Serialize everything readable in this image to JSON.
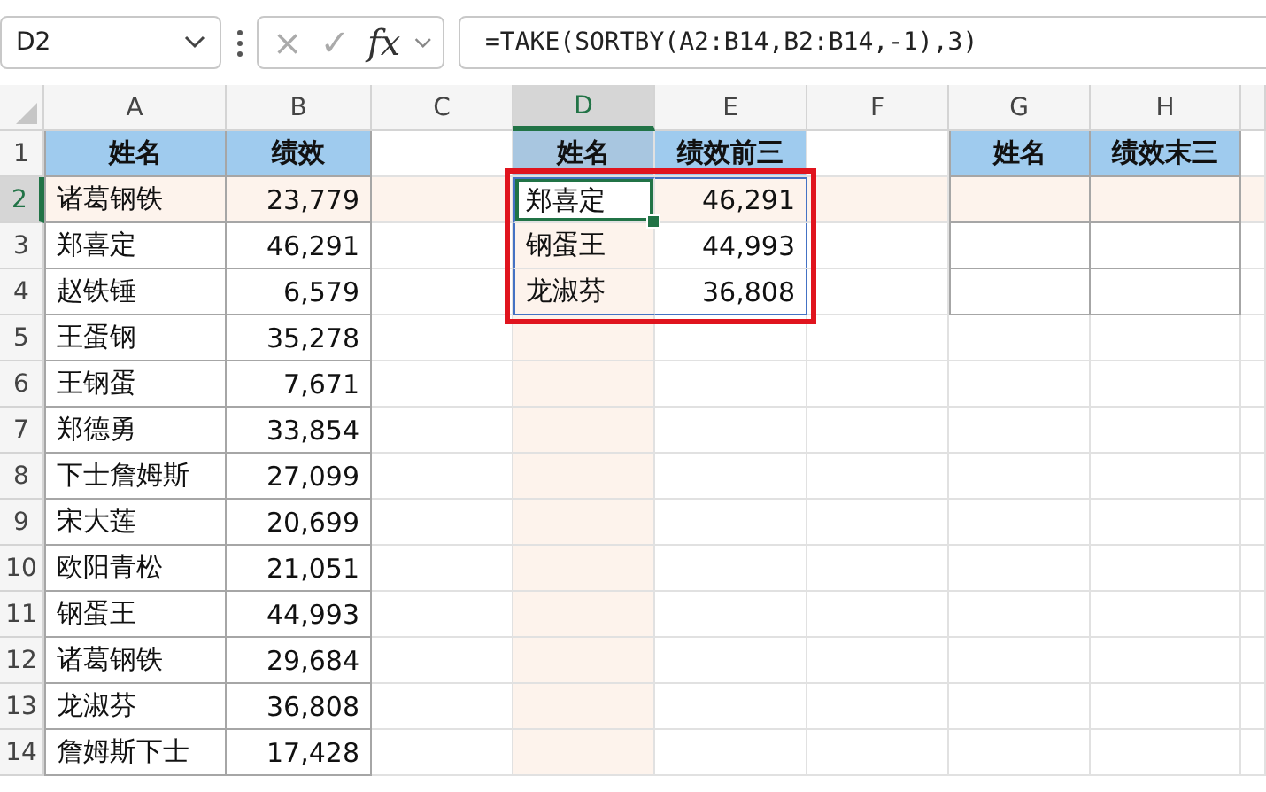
{
  "name_box": "D2",
  "formula_bar": {
    "cancel": "×",
    "enter": "✓",
    "function": "fx",
    "formula": "=TAKE(SORTBY(A2:B14,B2:B14,-1),3)"
  },
  "columns": [
    {
      "label": "A",
      "selected": false
    },
    {
      "label": "B",
      "selected": false
    },
    {
      "label": "C",
      "selected": false
    },
    {
      "label": "D",
      "selected": true
    },
    {
      "label": "E",
      "selected": false
    },
    {
      "label": "F",
      "selected": false
    },
    {
      "label": "G",
      "selected": false
    },
    {
      "label": "H",
      "selected": false
    }
  ],
  "rows": [
    {
      "number": "1",
      "selected": false,
      "kind": "header",
      "cells": {
        "A": "姓名",
        "B": "绩效",
        "D": "姓名",
        "E": "绩效前三",
        "G": "姓名",
        "H": "绩效末三"
      }
    },
    {
      "number": "2",
      "selected": true,
      "kind": "data",
      "cells": {
        "A": "诸葛钢铁",
        "B": "23,779",
        "D": "郑喜定",
        "E": "46,291"
      }
    },
    {
      "number": "3",
      "selected": false,
      "kind": "data",
      "cells": {
        "A": "郑喜定",
        "B": "46,291",
        "D": "钢蛋王",
        "E": "44,993"
      }
    },
    {
      "number": "4",
      "selected": false,
      "kind": "data",
      "cells": {
        "A": "赵铁锤",
        "B": "6,579",
        "D": "龙淑芬",
        "E": "36,808"
      }
    },
    {
      "number": "5",
      "selected": false,
      "kind": "data",
      "cells": {
        "A": "王蛋钢",
        "B": "35,278"
      }
    },
    {
      "number": "6",
      "selected": false,
      "kind": "data",
      "cells": {
        "A": "王钢蛋",
        "B": "7,671"
      }
    },
    {
      "number": "7",
      "selected": false,
      "kind": "data",
      "cells": {
        "A": "郑德勇",
        "B": "33,854"
      }
    },
    {
      "number": "8",
      "selected": false,
      "kind": "data",
      "cells": {
        "A": "下士詹姆斯",
        "B": "27,099"
      }
    },
    {
      "number": "9",
      "selected": false,
      "kind": "data",
      "cells": {
        "A": "宋大莲",
        "B": "20,699"
      }
    },
    {
      "number": "10",
      "selected": false,
      "kind": "data",
      "cells": {
        "A": "欧阳青松",
        "B": "21,051"
      }
    },
    {
      "number": "11",
      "selected": false,
      "kind": "data",
      "cells": {
        "A": "钢蛋王",
        "B": "44,993"
      }
    },
    {
      "number": "12",
      "selected": false,
      "kind": "data",
      "cells": {
        "A": "诸葛钢铁",
        "B": "29,684"
      }
    },
    {
      "number": "13",
      "selected": false,
      "kind": "data",
      "cells": {
        "A": "龙淑芬",
        "B": "36,808"
      }
    },
    {
      "number": "14",
      "selected": false,
      "kind": "data",
      "cells": {
        "A": "詹姆斯下士",
        "B": "17,428"
      }
    }
  ]
}
